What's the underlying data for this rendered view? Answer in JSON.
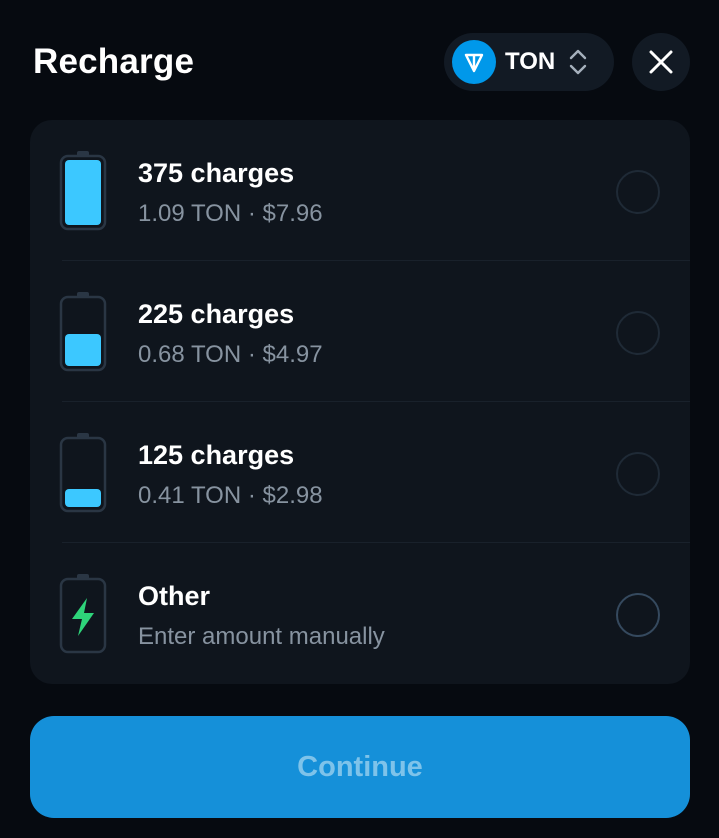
{
  "header": {
    "title": "Recharge",
    "currency": {
      "label": "TON",
      "logo_icon": "ton-logo-icon",
      "toggle_icon": "chevron-up-down-icon"
    },
    "close_icon": "close-icon"
  },
  "options": [
    {
      "title": "375 charges",
      "ton": "1.09 TON",
      "separator": "·",
      "usd": "$7.96",
      "battery_level": 1.0,
      "selected": false
    },
    {
      "title": "225 charges",
      "ton": "0.68 TON",
      "separator": "·",
      "usd": "$4.97",
      "battery_level": 0.5,
      "selected": false
    },
    {
      "title": "125 charges",
      "ton": "0.41 TON",
      "separator": "·",
      "usd": "$2.98",
      "battery_level": 0.25,
      "selected": false
    }
  ],
  "other": {
    "title": "Other",
    "subtitle": "Enter amount manually",
    "icon": "lightning-battery-icon",
    "selected": false
  },
  "continue_label": "Continue",
  "colors": {
    "background": "#060a10",
    "card": "#0f151d",
    "battery_fill": "#3cc8ff",
    "lightning": "#2ed47a",
    "button": "#1590d9",
    "button_text": "#7ec3ea",
    "muted_text": "#8793a0"
  }
}
